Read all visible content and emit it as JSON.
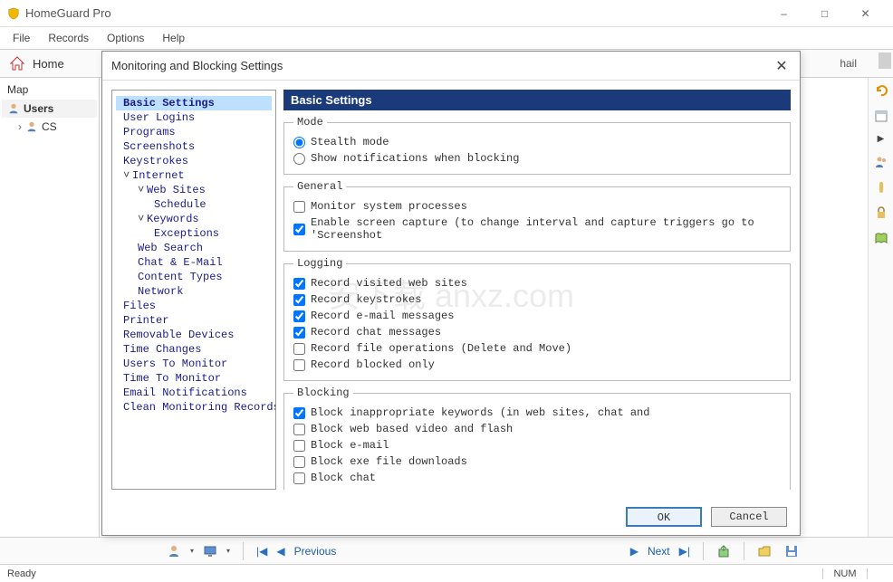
{
  "app": {
    "title": "HomeGuard Pro"
  },
  "menubar": [
    "File",
    "Records",
    "Options",
    "Help"
  ],
  "toolbar": {
    "home": "Home",
    "hail": "hail"
  },
  "sidebar": {
    "title": "Map",
    "users_label": "Users",
    "child_user": "CS"
  },
  "dialog": {
    "title": "Monitoring and Blocking Settings",
    "ok": "OK",
    "cancel": "Cancel",
    "panel_header": "Basic Settings",
    "tree": [
      {
        "l": 1,
        "label": "Basic Settings",
        "sel": true
      },
      {
        "l": 1,
        "label": "User Logins"
      },
      {
        "l": 1,
        "label": "Programs"
      },
      {
        "l": 1,
        "label": "Screenshots"
      },
      {
        "l": 1,
        "label": "Keystrokes"
      },
      {
        "l": 1,
        "label": "Internet",
        "exp": true
      },
      {
        "l": 2,
        "label": "Web Sites",
        "exp": true
      },
      {
        "l": 3,
        "label": "Schedule"
      },
      {
        "l": 2,
        "label": "Keywords",
        "exp": true
      },
      {
        "l": 3,
        "label": "Exceptions"
      },
      {
        "l": 2,
        "label": "Web Search"
      },
      {
        "l": 2,
        "label": "Chat & E-Mail"
      },
      {
        "l": 2,
        "label": "Content Types"
      },
      {
        "l": 2,
        "label": "Network"
      },
      {
        "l": 1,
        "label": "Files"
      },
      {
        "l": 1,
        "label": "Printer"
      },
      {
        "l": 1,
        "label": "Removable Devices"
      },
      {
        "l": 1,
        "label": "Time Changes"
      },
      {
        "l": 1,
        "label": "Users To Monitor"
      },
      {
        "l": 1,
        "label": "Time To Monitor"
      },
      {
        "l": 1,
        "label": "Email Notifications"
      },
      {
        "l": 1,
        "label": "Clean Monitoring Records"
      }
    ],
    "mode": {
      "legend": "Mode",
      "stealth": "Stealth mode",
      "notify": "Show notifications when blocking"
    },
    "general": {
      "legend": "General",
      "monitor_sys": "Monitor system processes",
      "enable_capture": "Enable screen capture (to change  interval and capture triggers go to 'Screenshot"
    },
    "logging": {
      "legend": "Logging",
      "items": [
        {
          "label": "Record visited web sites",
          "checked": true
        },
        {
          "label": "Record keystrokes",
          "checked": true
        },
        {
          "label": "Record e-mail messages",
          "checked": true
        },
        {
          "label": "Record chat messages",
          "checked": true
        },
        {
          "label": "Record file operations (Delete and Move)",
          "checked": false
        },
        {
          "label": "Record blocked only",
          "checked": false
        }
      ]
    },
    "blocking": {
      "legend": "Blocking",
      "items": [
        {
          "label": "Block inappropriate keywords (in web sites, chat and",
          "checked": true
        },
        {
          "label": "Block web based video and flash",
          "checked": false
        },
        {
          "label": "Block e-mail",
          "checked": false
        },
        {
          "label": "Block exe file downloads",
          "checked": false
        },
        {
          "label": "Block chat",
          "checked": false
        }
      ]
    }
  },
  "bottom": {
    "previous": "Previous",
    "next": "Next"
  },
  "status": {
    "ready": "Ready",
    "num": "NUM"
  },
  "watermark": "安下载 anxz.com"
}
